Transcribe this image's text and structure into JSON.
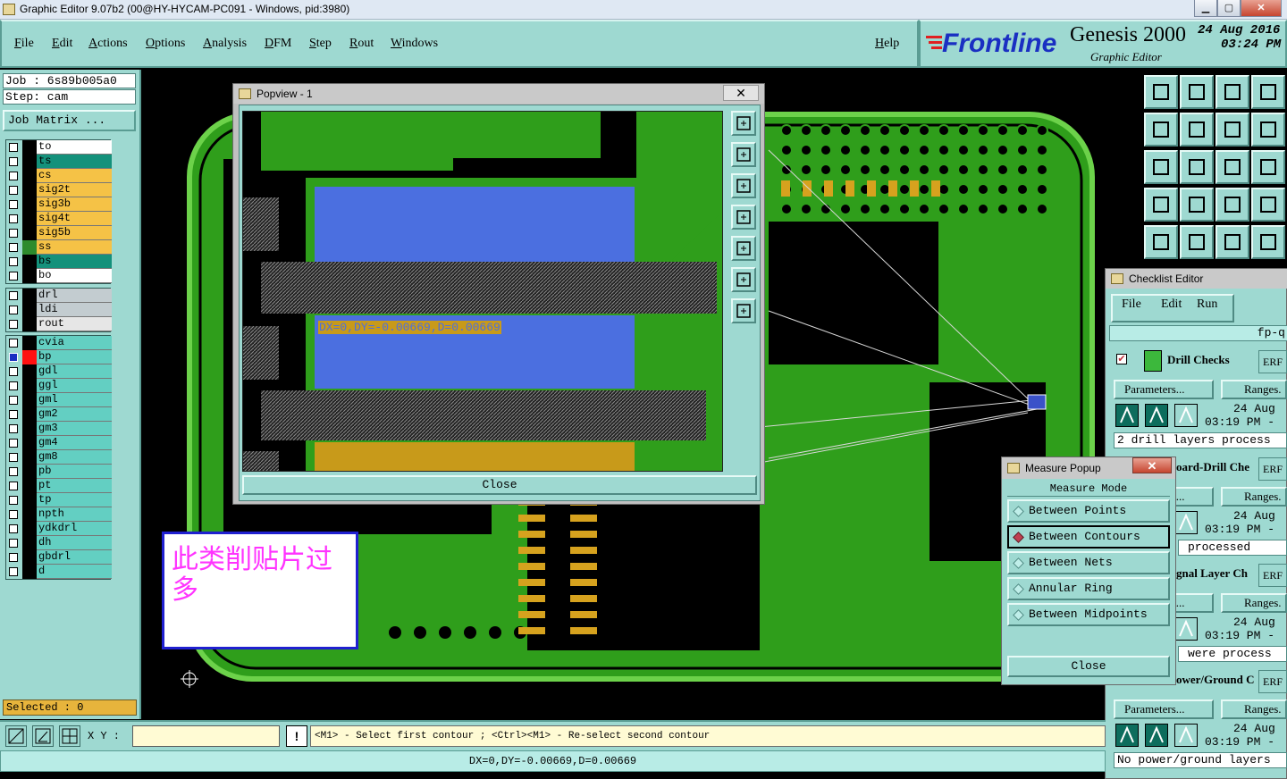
{
  "window": {
    "title": "Graphic Editor 9.07b2 (00@HY-HYCAM-PC091 - Windows, pid:3980)",
    "min": "▁",
    "max": "▢",
    "close": "✕"
  },
  "menubar": {
    "items": [
      "File",
      "Edit",
      "Actions",
      "Options",
      "Analysis",
      "DFM",
      "Step",
      "Rout",
      "Windows"
    ],
    "help": "Help"
  },
  "logo": {
    "brand": "Frontline",
    "product": "Genesis 2000",
    "subtitle": "Graphic Editor",
    "date": "24 Aug 2016",
    "time": "03:24 PM"
  },
  "left": {
    "job": "Job : 6s89b005a0",
    "step": "Step: cam",
    "job_matrix": "Job Matrix ...",
    "groups": [
      [
        {
          "name": "to",
          "color": "#ffffff",
          "swatch": "#000000"
        },
        {
          "name": "ts",
          "color": "#14917b",
          "swatch": "#000000"
        },
        {
          "name": "cs",
          "color": "#f5c246",
          "swatch": "#000000"
        },
        {
          "name": "sig2t",
          "color": "#f5c246",
          "swatch": "#000000"
        },
        {
          "name": "sig3b",
          "color": "#f5c246",
          "swatch": "#000000"
        },
        {
          "name": "sig4t",
          "color": "#f5c246",
          "swatch": "#000000"
        },
        {
          "name": "sig5b",
          "color": "#f5c246",
          "swatch": "#000000"
        },
        {
          "name": "ss",
          "color": "#f5c246",
          "swatch": "#2d8b2d"
        },
        {
          "name": "bs",
          "color": "#14917b",
          "swatch": "#000000"
        },
        {
          "name": "bo",
          "color": "#ffffff",
          "swatch": "#000000"
        }
      ],
      [
        {
          "name": "drl",
          "color": "#c3ccd0",
          "swatch": "#000000"
        },
        {
          "name": "ldi",
          "color": "#c3ccd0",
          "swatch": "#000000"
        },
        {
          "name": "rout",
          "color": "#e6e6e6",
          "swatch": "#000000"
        }
      ],
      [
        {
          "name": "cvia",
          "color": "#63cfc2",
          "swatch": "#000000"
        },
        {
          "name": "bp",
          "color": "#63cfc2",
          "swatch": "#ff1111",
          "active": true
        },
        {
          "name": "gdl",
          "color": "#63cfc2",
          "swatch": "#000000"
        },
        {
          "name": "ggl",
          "color": "#63cfc2",
          "swatch": "#000000"
        },
        {
          "name": "gml",
          "color": "#63cfc2",
          "swatch": "#000000"
        },
        {
          "name": "gm2",
          "color": "#63cfc2",
          "swatch": "#000000"
        },
        {
          "name": "gm3",
          "color": "#63cfc2",
          "swatch": "#000000"
        },
        {
          "name": "gm4",
          "color": "#63cfc2",
          "swatch": "#000000"
        },
        {
          "name": "gm8",
          "color": "#63cfc2",
          "swatch": "#000000"
        },
        {
          "name": "pb",
          "color": "#63cfc2",
          "swatch": "#000000"
        },
        {
          "name": "pt",
          "color": "#63cfc2",
          "swatch": "#000000"
        },
        {
          "name": "tp",
          "color": "#63cfc2",
          "swatch": "#000000"
        },
        {
          "name": "npth",
          "color": "#63cfc2",
          "swatch": "#000000"
        },
        {
          "name": "ydkdrl",
          "color": "#63cfc2",
          "swatch": "#000000"
        },
        {
          "name": "dh",
          "color": "#63cfc2",
          "swatch": "#000000"
        },
        {
          "name": "gbdrl",
          "color": "#63cfc2",
          "swatch": "#000000"
        },
        {
          "name": "d",
          "color": "#63cfc2",
          "swatch": "#000000"
        }
      ]
    ],
    "selected": "Selected : 0"
  },
  "status": {
    "xy_label": "X Y :",
    "xy_value": "",
    "warn": "!",
    "prompt": "<M1> - Select first contour ; <Ctrl><M1> - Re-select second contour",
    "measure_result": "DX=0,DY=-0.00669,D=0.00669"
  },
  "popview": {
    "title": "Popview - 1",
    "close_x": "✕",
    "readout": "DX=0,DY=-0.00669,D=0.00669",
    "close": "Close"
  },
  "note": {
    "text": "此类削贴片过多"
  },
  "checklist": {
    "title": "Checklist Editor",
    "menu": [
      "File",
      "Edit",
      "Run"
    ],
    "name": "fp-q",
    "erf": "ERF",
    "params": "Parameters...",
    "ranges": "Ranges.",
    "date": "24 Aug",
    "time": "03:19 PM -",
    "items": [
      {
        "name": "Drill Checks",
        "status": "2 drill layers process"
      },
      {
        "name": "oard-Drill Che",
        "status": "processed"
      },
      {
        "name": "gnal Layer Ch",
        "status": "were process"
      },
      {
        "name": "ower/Ground C",
        "status": "No power/ground layers"
      }
    ]
  },
  "measure": {
    "title": "Measure Popup",
    "close_x": "✕",
    "mode_label": "Measure Mode",
    "options": [
      "Between Points",
      "Between Contours",
      "Between Nets",
      "Annular Ring",
      "Between Midpoints"
    ],
    "active": "Between Contours",
    "close": "Close"
  }
}
